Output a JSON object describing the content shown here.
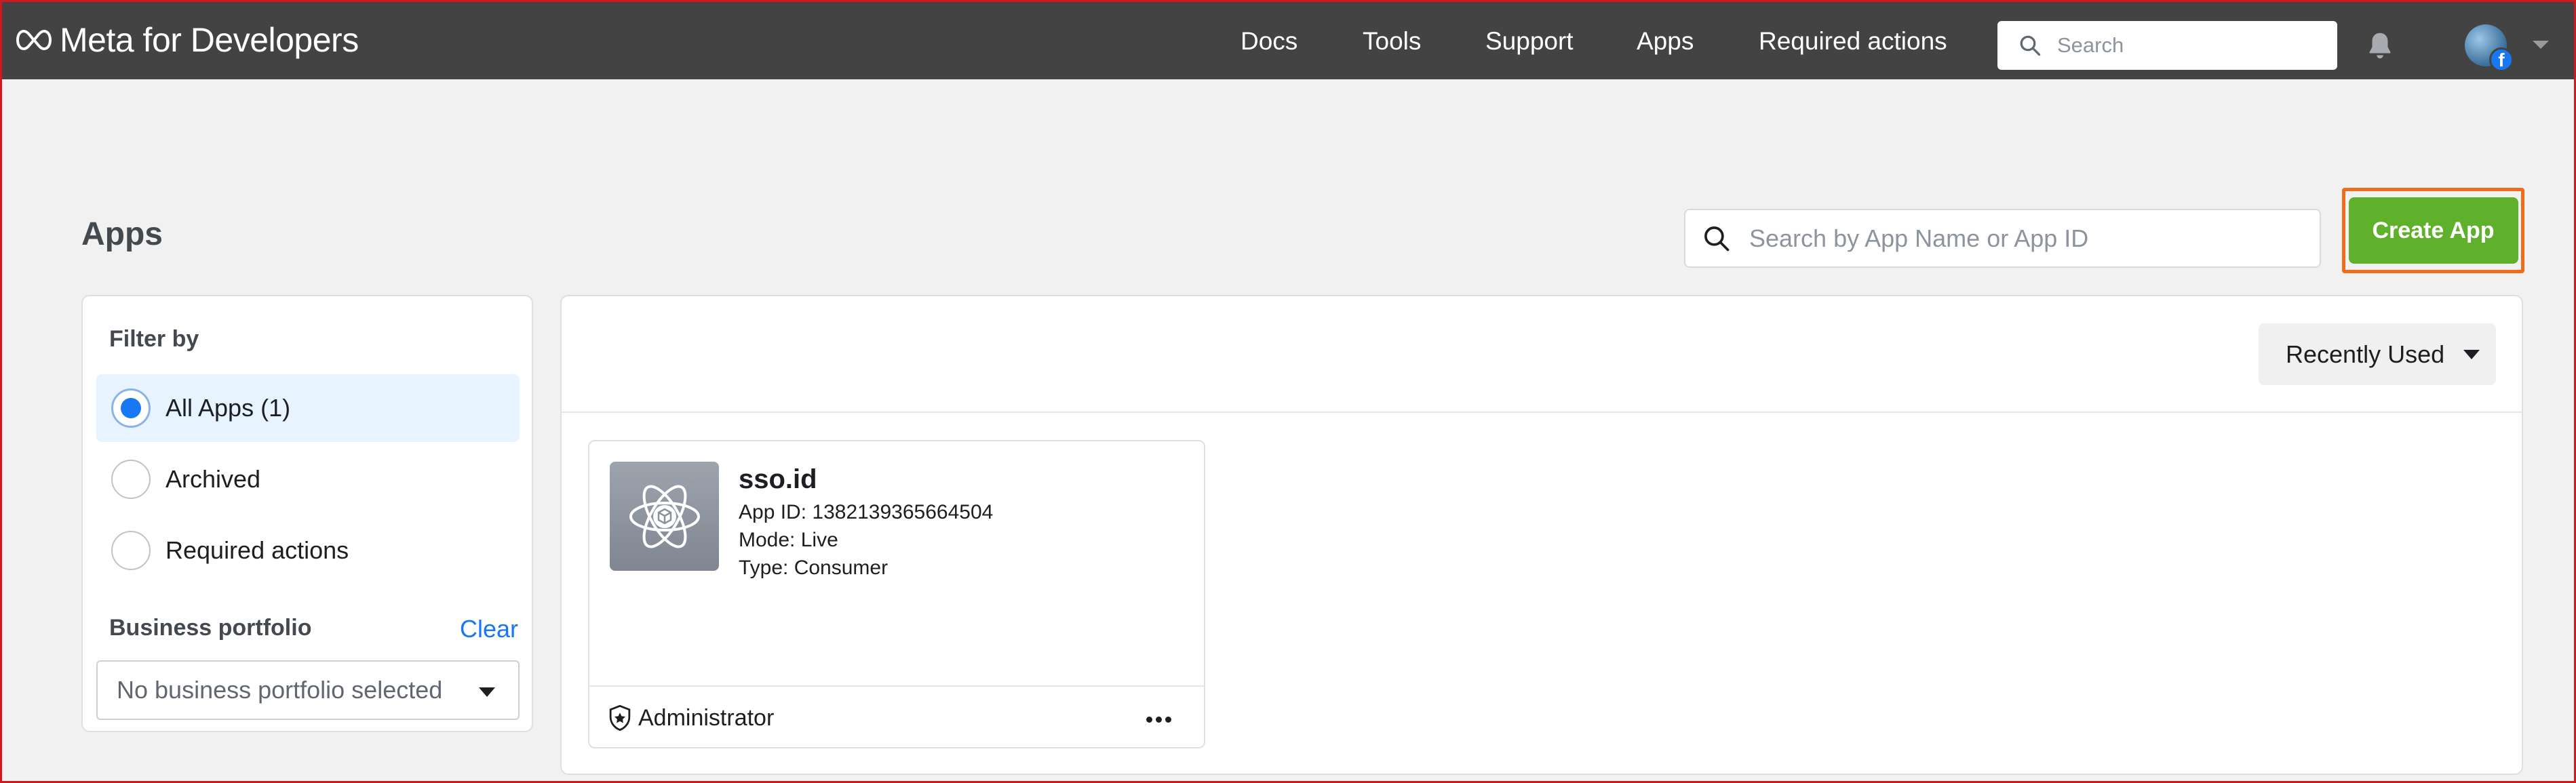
{
  "brand": {
    "name": "Meta for Developers"
  },
  "nav": {
    "items": [
      {
        "label": "Docs"
      },
      {
        "label": "Tools"
      },
      {
        "label": "Support"
      },
      {
        "label": "Apps"
      },
      {
        "label": "Required actions"
      }
    ],
    "search_placeholder": "Search"
  },
  "page": {
    "title": "Apps",
    "search_placeholder": "Search by App Name or App ID",
    "create_label": "Create App"
  },
  "filter": {
    "heading": "Filter by",
    "options": [
      {
        "label": "All Apps (1)",
        "selected": true
      },
      {
        "label": "Archived",
        "selected": false
      },
      {
        "label": "Required actions",
        "selected": false
      }
    ],
    "business_portfolio": {
      "heading": "Business portfolio",
      "clear_label": "Clear",
      "selected": "No business portfolio selected"
    }
  },
  "sort": {
    "label": "Recently Used"
  },
  "apps": [
    {
      "name": "sso.id",
      "app_id": "App ID: 1382139365664504",
      "mode": "Mode: Live",
      "type": "Type: Consumer",
      "role": "Administrator"
    }
  ],
  "colors": {
    "topbar": "#434343",
    "primary_green": "#5fb12c",
    "highlight_orange": "#f26b1d",
    "link_blue": "#1877f2",
    "selected_bg": "#e7f3ff"
  },
  "icons": {
    "brand": "meta-infinity-icon",
    "search": "search-icon",
    "notifications": "bell-icon",
    "app": "atom-icon",
    "role": "shield-star-icon",
    "more": "more-dots-icon",
    "dropdown": "caret-down-icon"
  }
}
